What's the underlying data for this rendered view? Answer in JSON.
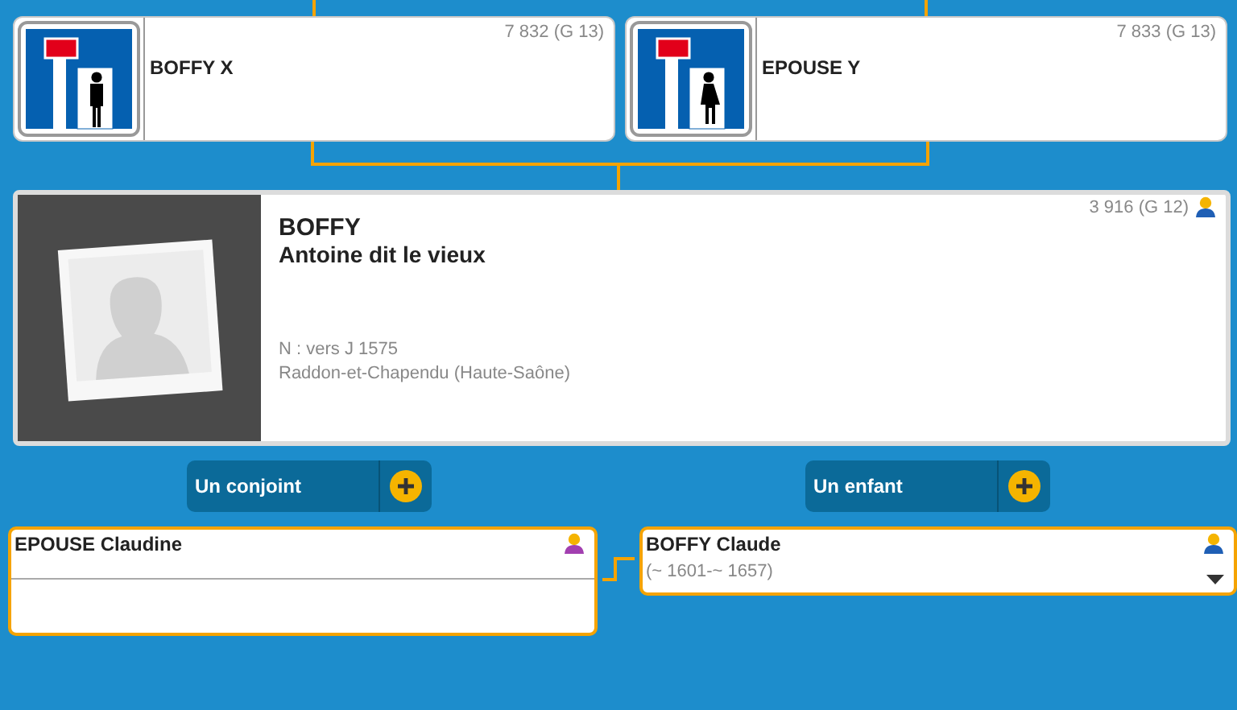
{
  "parents": [
    {
      "name": "BOFFY X",
      "sosa": "7 832 (G 13)",
      "kind": "male"
    },
    {
      "name": "EPOUSE Y",
      "sosa": "7 833 (G 13)",
      "kind": "female"
    }
  ],
  "person": {
    "surname": "BOFFY",
    "given": "Antoine dit le vieux",
    "sosa": "3 916 (G 12)",
    "kind": "male",
    "birth": "N : vers J 1575",
    "place": "Raddon-et-Chapendu (Haute-Saône)"
  },
  "add_buttons": [
    {
      "label": "Un conjoint"
    },
    {
      "label": "Un enfant"
    }
  ],
  "spouse": {
    "name": "EPOUSE Claudine",
    "kind": "female"
  },
  "child": {
    "name": "BOFFY Claude",
    "dates": "(~ 1601-~ 1657)",
    "kind": "male"
  }
}
